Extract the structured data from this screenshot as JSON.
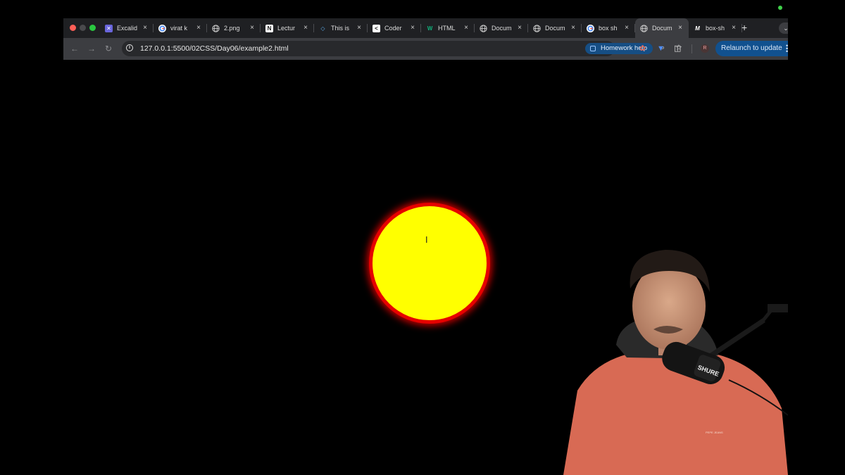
{
  "browser": {
    "tabs": [
      {
        "title": "Excalid",
        "icon": "excalidraw-icon"
      },
      {
        "title": "virat k",
        "icon": "google-icon"
      },
      {
        "title": "2.png",
        "icon": "globe-icon"
      },
      {
        "title": "Lectur",
        "icon": "notion-icon"
      },
      {
        "title": "This is",
        "icon": "diamond-icon"
      },
      {
        "title": "Coder",
        "icon": "codepen-icon"
      },
      {
        "title": "HTML",
        "icon": "w3schools-icon"
      },
      {
        "title": "Docum",
        "icon": "globe-icon"
      },
      {
        "title": "Docum",
        "icon": "globe-icon"
      },
      {
        "title": "box sh",
        "icon": "google-icon"
      },
      {
        "title": "Docum",
        "icon": "globe-icon",
        "active": true
      },
      {
        "title": "box-sh",
        "icon": "mdn-icon"
      }
    ],
    "tab_close": "×",
    "new_tab": "+",
    "url": "127.0.0.1:5500/02CSS/Day06/example2.html",
    "homework_help": "Homework help",
    "profile_initial": "R",
    "relaunch_label": "Relaunch to update"
  },
  "page": {
    "circle": {
      "fill": "#ffff00",
      "border": "#e60000",
      "glow": "#c40000"
    },
    "background": "#000000"
  },
  "webcam": {
    "shirt_logo": "PEPE JEANS",
    "mic_brand": "SHURE"
  }
}
